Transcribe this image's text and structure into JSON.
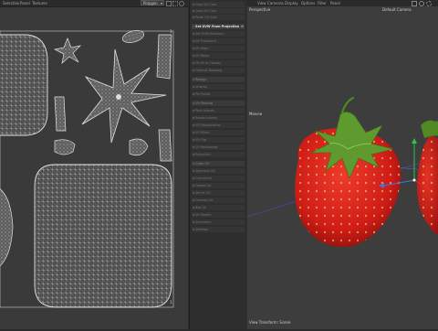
{
  "uv_editor": {
    "menu": [
      "Selection",
      "Panel",
      "Textures"
    ],
    "mode_label": "Polygon",
    "corner_top_left": "0",
    "corner_top_right": "1",
    "corner_bottom_right": "1"
  },
  "operations": {
    "items": [
      {
        "label": "Copy UV Coor",
        "state": "normal"
      },
      {
        "label": "Copy UV Coor",
        "state": "normal"
      },
      {
        "label": "Paste UV Coor",
        "state": "normal"
      },
      {
        "label": "Set UVW From Projection",
        "state": "active"
      },
      {
        "label": "Set UVW Selection",
        "state": "normal"
      },
      {
        "label": "UV Transform",
        "state": "normal"
      },
      {
        "label": "UV Align",
        "state": "normal"
      },
      {
        "label": "UV Relax",
        "state": "normal"
      },
      {
        "label": "Fit UV to Canvas",
        "state": "normal"
      },
      {
        "label": "Optimal Mapping",
        "state": "normal"
      },
      {
        "label": "Realign",
        "state": "section"
      },
      {
        "label": "Unwrap",
        "state": "normal"
      },
      {
        "label": "Pin Points",
        "state": "normal"
      },
      {
        "label": "UV Packing",
        "state": "section"
      },
      {
        "label": "Pack Islands",
        "state": "normal"
      },
      {
        "label": "Rotate Islands",
        "state": "normal"
      },
      {
        "label": "UV Manipulation",
        "state": "normal"
      },
      {
        "label": "UV Mirror",
        "state": "normal"
      },
      {
        "label": "UV Flip",
        "state": "normal"
      },
      {
        "label": "UV Retopology",
        "state": "normal"
      },
      {
        "label": "Projection",
        "state": "normal"
      },
      {
        "label": "Cubic UV",
        "state": "section"
      },
      {
        "label": "Spherical UV",
        "state": "normal"
      },
      {
        "label": "Cylindrical",
        "state": "normal"
      },
      {
        "label": "Frontal UV",
        "state": "normal"
      },
      {
        "label": "Shrink UV",
        "state": "normal"
      },
      {
        "label": "Camera UV",
        "state": "normal"
      },
      {
        "label": "Box UV",
        "state": "normal"
      },
      {
        "label": "UV Sheets",
        "state": "normal"
      },
      {
        "label": "Symmetry",
        "state": "normal"
      },
      {
        "label": "Settings",
        "state": "normal"
      }
    ]
  },
  "viewport": {
    "menu": [
      "View",
      "Cameras",
      "Display",
      "Options",
      "Filter",
      "Panel"
    ],
    "projection_label": "Perspective",
    "camera_label": "Default Camera",
    "object_label": "Move",
    "status_text": "View Transform: Scene",
    "colors": {
      "strawberry_red": "#d8201c",
      "leaf_green": "#5f9a2e",
      "background": "#3d3d3d"
    }
  }
}
